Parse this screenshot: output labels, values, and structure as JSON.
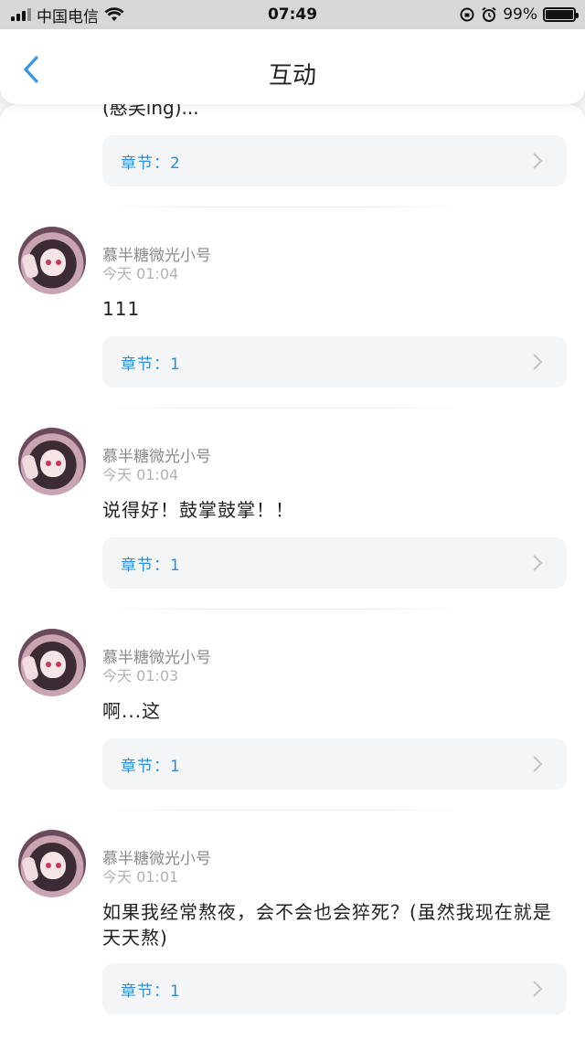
{
  "status_bar": {
    "carrier": "中国电信",
    "time": "07:49",
    "battery": "99%",
    "battery_level": 0.99
  },
  "nav": {
    "title": "互动",
    "back_icon": "chevron-left-icon"
  },
  "top_partial": {
    "text": "(憨笑ing)...",
    "chapter": "章节：2"
  },
  "comments": [
    {
      "username": "慕半糖微光小号",
      "time": "今天 01:04",
      "text": "111",
      "chapter": "章节：1"
    },
    {
      "username": "慕半糖微光小号",
      "time": "今天 01:04",
      "text": "说得好！鼓掌鼓掌！！",
      "chapter": "章节：1"
    },
    {
      "username": "慕半糖微光小号",
      "time": "今天 01:03",
      "text": "啊...这",
      "chapter": "章节：1"
    },
    {
      "username": "慕半糖微光小号",
      "time": "今天 01:01",
      "text": "如果我经常熬夜，会不会也会猝死？(虽然我现在就是天天熬)",
      "chapter": "章节：1"
    }
  ],
  "colors": {
    "accent": "#2d8ed6",
    "back_icon": "#3a95e0"
  }
}
